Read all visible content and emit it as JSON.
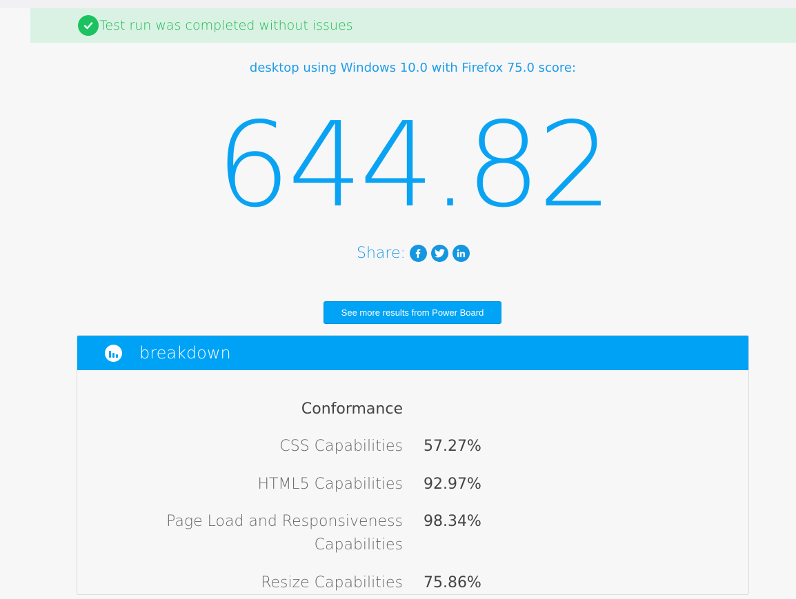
{
  "alert": {
    "message": "Test run was completed without issues",
    "color": "#20b84f",
    "background": "#d9f2e4"
  },
  "summary": {
    "subtitle": "desktop using Windows 10.0 with Firefox 75.0 score:",
    "score": "644.82",
    "accent": "#0aa3f3"
  },
  "share": {
    "label": "Share:",
    "icons": [
      "facebook-icon",
      "twitter-icon",
      "linkedin-icon"
    ]
  },
  "powerboard_button": {
    "label": "See more results from Power Board"
  },
  "breakdown": {
    "title": "breakdown",
    "icon": "bar-chart-icon",
    "section_heading": "Conformance",
    "rows": [
      {
        "label_line1": "CSS Capabilities",
        "label_line2": "",
        "value": "57.27%"
      },
      {
        "label_line1": "HTML5 Capabilities",
        "label_line2": "",
        "value": "92.97%"
      },
      {
        "label_line1": "Page Load and Responsiveness",
        "label_line2": "Capabilities",
        "value": "98.34%"
      },
      {
        "label_line1": "Resize Capabilities",
        "label_line2": "",
        "value": "75.86%"
      }
    ]
  }
}
